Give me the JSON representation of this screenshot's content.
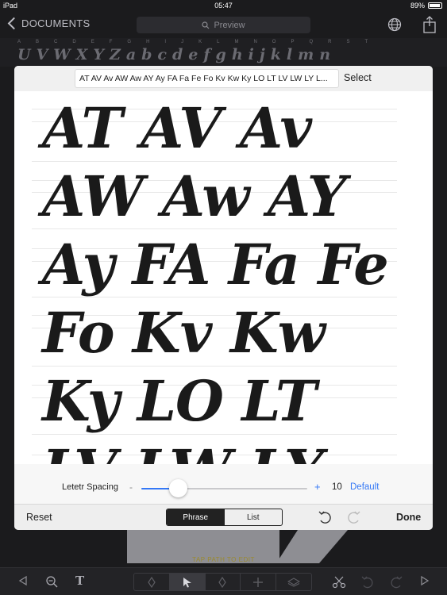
{
  "status": {
    "device": "iPad",
    "time": "05:47",
    "battery": "89%",
    "battery_level": 0.89
  },
  "nav": {
    "back_label": "DOCUMENTS",
    "preview_placeholder": "Preview"
  },
  "glyph_strip": {
    "letters": [
      "A",
      "B",
      "C",
      "D",
      "E",
      "F",
      "G",
      "H",
      "I",
      "J",
      "K",
      "L",
      "M",
      "N",
      "O",
      "P",
      "Q",
      "R",
      "S",
      "T"
    ],
    "sample": "UVWXYZabcdefghijklmn"
  },
  "dialog": {
    "phrase": "AT AV Av AW Aw AY Ay  FA Fa Fe Fo  Kv Kw Ky LO LT LV LW LY L...",
    "select_label": "Select",
    "specimen_lines": [
      "AT AV Av",
      "AW Aw AY",
      "Ay  FA Fa Fe",
      "Fo  Kv Kw",
      "Ky LO LT",
      "LV LW LY"
    ],
    "spacing": {
      "label": "Letetr Spacing",
      "minus": "-",
      "plus": "+",
      "value": "10",
      "default_label": "Default",
      "slider_fraction": 0.22
    },
    "bottom": {
      "reset_label": "Reset",
      "tabs": [
        "Phrase",
        "List"
      ],
      "active_tab": "Phrase",
      "done_label": "Done"
    }
  },
  "canvas_hint": "TAP PATH TO EDIT",
  "colors": {
    "accent": "#3478f6",
    "background": "#1b1b1d",
    "hint": "#9a8a2e"
  }
}
